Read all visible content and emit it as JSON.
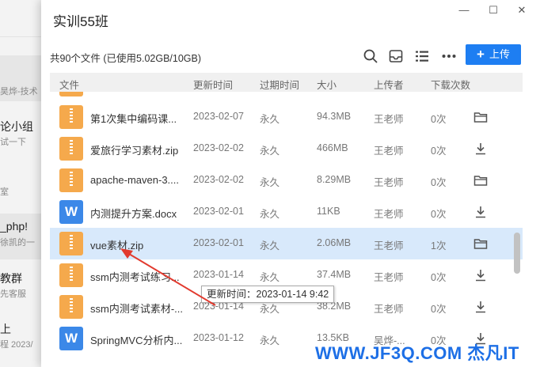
{
  "background_app": {
    "items": [
      {
        "title": "",
        "subtitle": "昊烨-技术"
      },
      {
        "title": "论小组",
        "subtitle": "试一下"
      },
      {
        "title": "室",
        "subtitle": ""
      },
      {
        "title": "_php!",
        "subtitle": "徐凯的一"
      },
      {
        "title": "教群",
        "subtitle": "先客服"
      },
      {
        "title": "上",
        "subtitle": "程 2023/"
      }
    ]
  },
  "window": {
    "title": "实训55班",
    "controls": {
      "minimize": "—",
      "maximize": "☐",
      "close": "✕"
    }
  },
  "toolbar": {
    "info": "共90个文件 (已使用5.02GB/10GB)",
    "icons": [
      "search-icon",
      "inbox-icon",
      "list-view-icon",
      "more-icon"
    ],
    "upload_label": "上传",
    "accent_color": "#1e7ef2"
  },
  "table": {
    "columns": [
      "文件",
      "更新时间",
      "过期时间",
      "大小",
      "上传者",
      "下载次数"
    ],
    "rows": [
      {
        "type": "zip",
        "name": "第1次集中编码课...",
        "updated": "2023-02-07",
        "expires": "永久",
        "size": "94.3MB",
        "uploader": "王老师",
        "downloads": "0次",
        "action": "folder-icon"
      },
      {
        "type": "zip",
        "name": "爱旅行学习素材.zip",
        "updated": "2023-02-02",
        "expires": "永久",
        "size": "466MB",
        "uploader": "王老师",
        "downloads": "0次",
        "action": "download-icon"
      },
      {
        "type": "zip",
        "name": "apache-maven-3....",
        "updated": "2023-02-02",
        "expires": "永久",
        "size": "8.29MB",
        "uploader": "王老师",
        "downloads": "0次",
        "action": "folder-icon"
      },
      {
        "type": "doc",
        "name": "内测提升方案.docx",
        "updated": "2023-02-01",
        "expires": "永久",
        "size": "11KB",
        "uploader": "王老师",
        "downloads": "0次",
        "action": "download-icon"
      },
      {
        "type": "zip",
        "name": "vue素材.zip",
        "updated": "2023-02-01",
        "expires": "永久",
        "size": "2.06MB",
        "uploader": "王老师",
        "downloads": "1次",
        "action": "folder-icon",
        "highlighted": true
      },
      {
        "type": "zip",
        "name": "ssm内测考试练习...",
        "updated": "2023-01-14",
        "expires": "永久",
        "size": "37.4MB",
        "uploader": "王老师",
        "downloads": "0次",
        "action": "download-icon"
      },
      {
        "type": "zip",
        "name": "ssm内测考试素材-...",
        "updated": "2023-01-14",
        "expires": "永久",
        "size": "38.2MB",
        "uploader": "王老师",
        "downloads": "0次",
        "action": "download-icon"
      },
      {
        "type": "doc",
        "name": "SpringMVC分析内...",
        "updated": "2023-01-12",
        "expires": "永久",
        "size": "13.5KB",
        "uploader": "吴烨-...",
        "downloads": "0次",
        "action": "download-icon"
      }
    ]
  },
  "tooltip": "更新时间：2023-01-14 9:42",
  "watermark": "WWW.JF3Q.COM 杰凡IT"
}
